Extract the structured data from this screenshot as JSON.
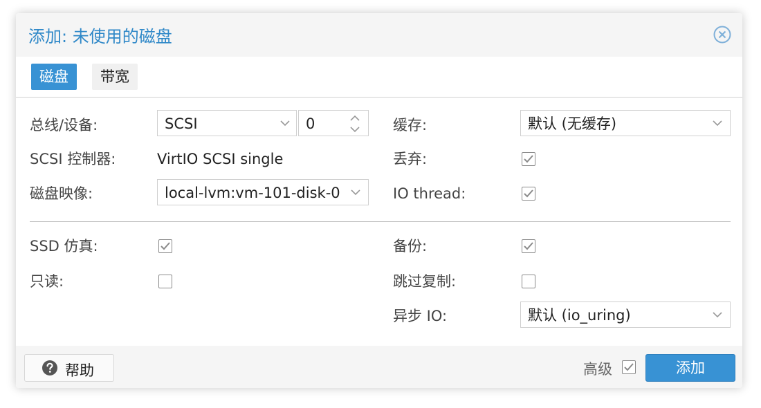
{
  "dialog": {
    "title": "添加: 未使用的磁盘",
    "close_icon": "close-circle-icon"
  },
  "tabs": [
    {
      "label": "磁盘",
      "active": true
    },
    {
      "label": "带宽",
      "active": false
    }
  ],
  "form": {
    "bus_device": {
      "label": "总线/设备:",
      "bus": "SCSI",
      "device": "0"
    },
    "scsi_controller": {
      "label": "SCSI 控制器:",
      "value": "VirtIO SCSI single"
    },
    "disk_image": {
      "label": "磁盘映像:",
      "value": "local-lvm:vm-101-disk-0"
    },
    "cache": {
      "label": "缓存:",
      "value": "默认 (无缓存)"
    },
    "discard": {
      "label": "丢弃:",
      "checked": true,
      "disabled": true
    },
    "io_thread": {
      "label": "IO thread:",
      "checked": true,
      "disabled": true
    },
    "ssd_emulation": {
      "label": "SSD 仿真:",
      "checked": true,
      "disabled": true
    },
    "readonly": {
      "label": "只读:",
      "checked": false
    },
    "backup": {
      "label": "备份:",
      "checked": true,
      "disabled": true
    },
    "skip_replication": {
      "label": "跳过复制:",
      "checked": false
    },
    "async_io": {
      "label": "异步 IO:",
      "value": "默认 (io_uring)"
    }
  },
  "footer": {
    "help_label": "帮助",
    "help_icon": "question-circle-icon",
    "advanced_label": "高级",
    "advanced_checked": true,
    "add_label": "添加"
  },
  "colors": {
    "accent": "#3892d4",
    "title": "#2f88c8",
    "header_bg": "#f5f5f5"
  }
}
